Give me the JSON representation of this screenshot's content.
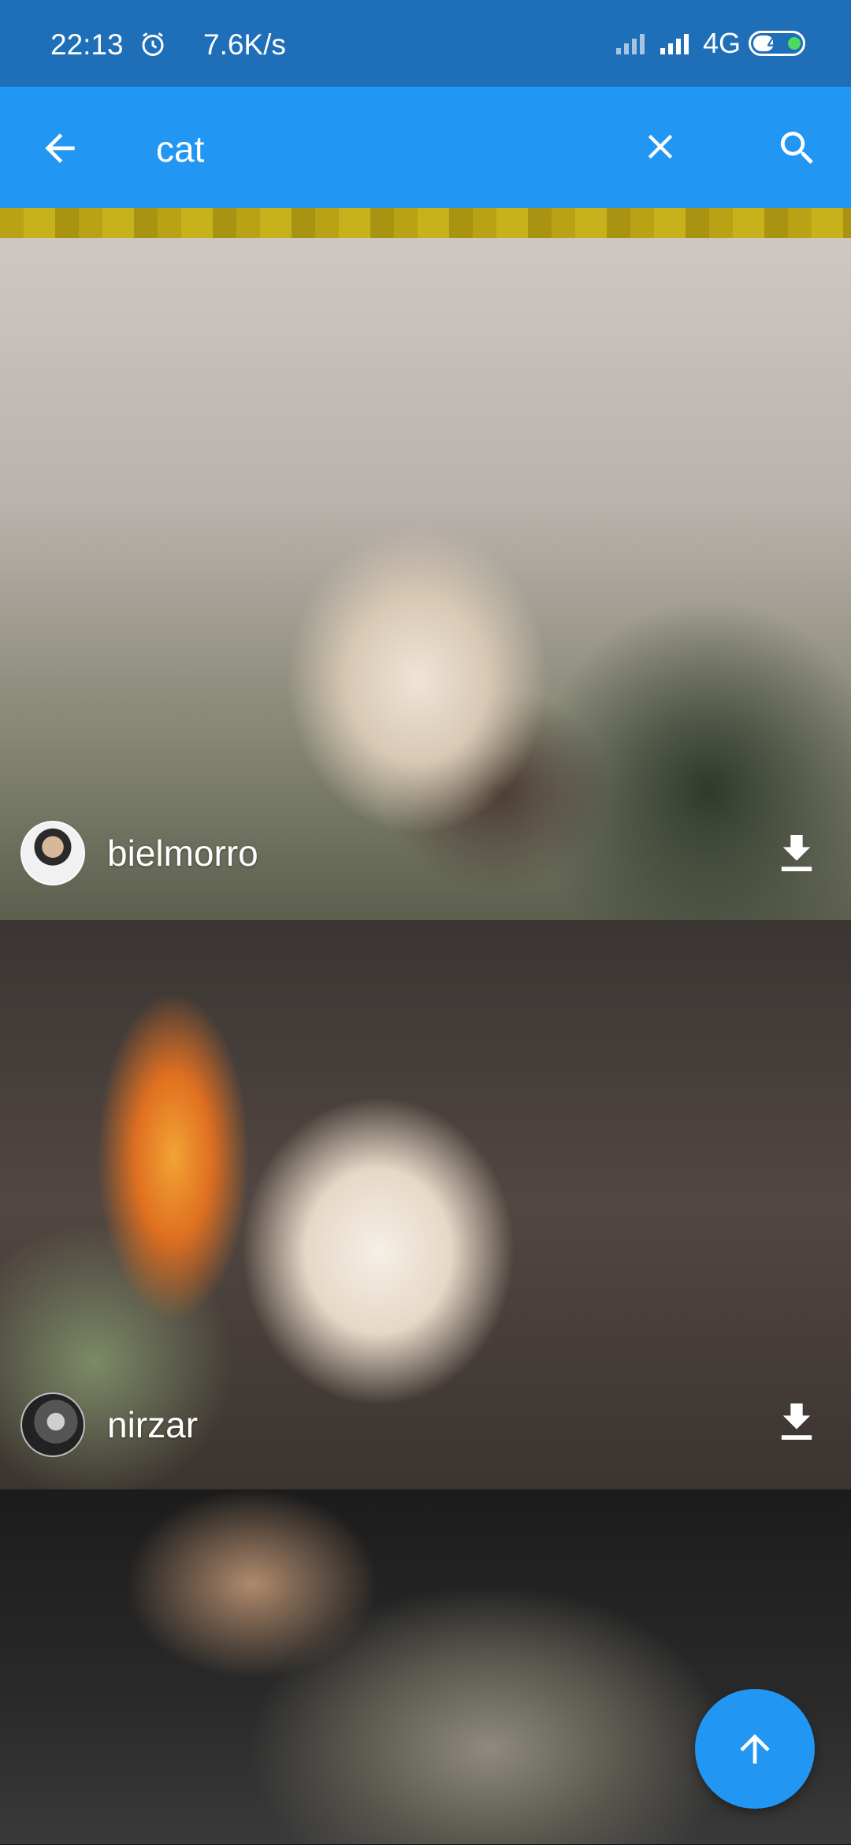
{
  "status_bar": {
    "time": "22:13",
    "speed": "7.6K/s",
    "network": "4G",
    "battery": "42"
  },
  "app_bar": {
    "query": "cat",
    "back_icon": "arrow-left-icon",
    "clear_icon": "close-icon",
    "search_icon": "search-icon"
  },
  "photos": [
    {
      "author": "bielmorro",
      "avatar_icon": "avatar",
      "action_icon": "download-icon"
    },
    {
      "author": "nirzar",
      "avatar_icon": "avatar",
      "action_icon": "download-icon"
    },
    {
      "author": "",
      "avatar_icon": "",
      "action_icon": ""
    }
  ],
  "fab": {
    "icon": "arrow-up-icon"
  },
  "colors": {
    "status_bar": "#1f6eb8",
    "app_bar": "#2196f3",
    "fab": "#2196f3"
  }
}
